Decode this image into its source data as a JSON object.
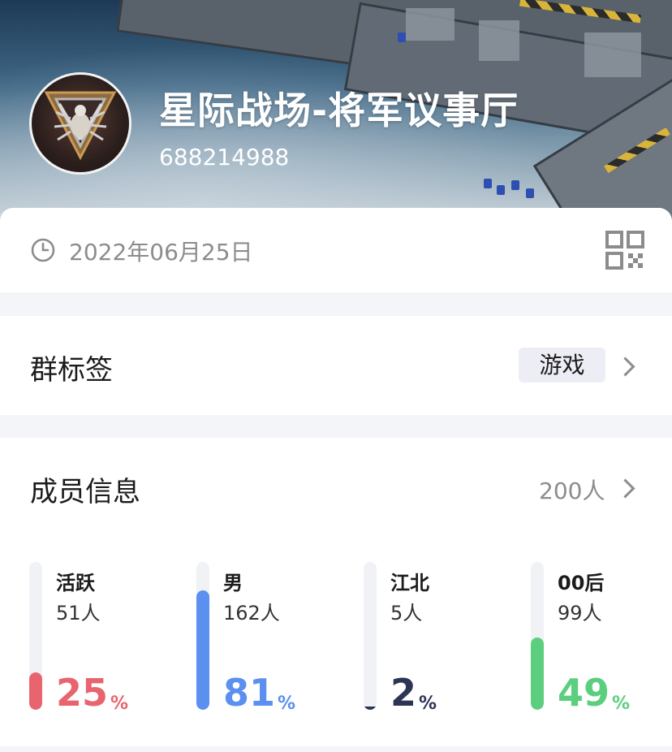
{
  "header": {
    "group_name": "星际战场-将军议事厅",
    "group_id": "688214988"
  },
  "info": {
    "date": "2022年06月25日",
    "clock_icon": "clock-icon",
    "qr_icon": "qr-code-icon"
  },
  "tags": {
    "title": "群标签",
    "value": "游戏"
  },
  "members": {
    "title": "成员信息",
    "count": "200人",
    "stats": [
      {
        "label": "活跃",
        "count": "51人",
        "percent": "25",
        "sign": "%",
        "fill": 0.25,
        "color": "#e8646f"
      },
      {
        "label": "男",
        "count": "162人",
        "percent": "81",
        "sign": "%",
        "fill": 0.81,
        "color": "#5b8ff0"
      },
      {
        "label": "江北",
        "count": "5人",
        "percent": "2",
        "sign": "%",
        "fill": 0.02,
        "color": "#2d3555"
      },
      {
        "label": "00后",
        "count": "99人",
        "percent": "49",
        "sign": "%",
        "fill": 0.49,
        "color": "#5ccf7f"
      }
    ]
  }
}
